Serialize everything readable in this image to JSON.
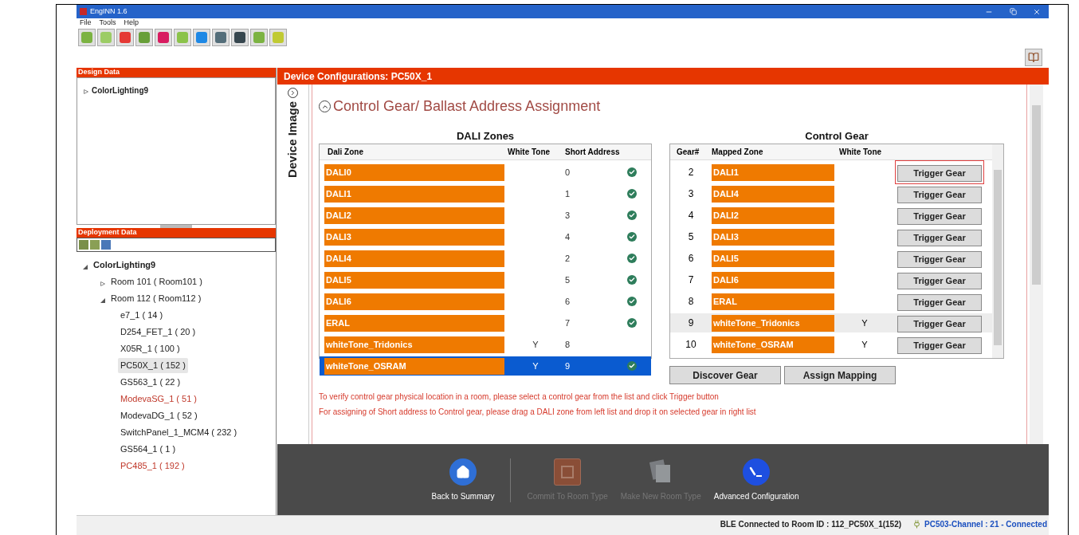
{
  "window": {
    "title": "EngINN 1.6"
  },
  "menu": [
    "File",
    "Tools",
    "Help"
  ],
  "design_data": {
    "title": "Design Data",
    "tree": [
      {
        "label": "ColorLighting9",
        "expanded": false
      }
    ]
  },
  "deployment_data": {
    "title": "Deployment Data",
    "tree": [
      {
        "label": "ColorLighting9",
        "expanded": true,
        "children": [
          {
            "label": "Room 101 ( Room101 )",
            "expanded": false
          },
          {
            "label": "Room 112 ( Room112 )",
            "expanded": true,
            "children": [
              {
                "label": "e7_1  ( 14 )",
                "selected": false,
                "color": "#222222"
              },
              {
                "label": "D254_FET_1  ( 20 )",
                "selected": false,
                "color": "#222222"
              },
              {
                "label": "X05R_1  ( 100 )",
                "selected": false,
                "color": "#222222"
              },
              {
                "label": "PC50X_1  ( 152 )",
                "selected": true,
                "color": "#222222"
              },
              {
                "label": "GS563_1  ( 22 )",
                "selected": false,
                "color": "#222222"
              },
              {
                "label": "ModevaSG_1  ( 51 )",
                "selected": false,
                "color": "#c0392b"
              },
              {
                "label": "ModevaDG_1  ( 52 )",
                "selected": false,
                "color": "#222222"
              },
              {
                "label": "SwitchPanel_1_MCM4  ( 232 )",
                "selected": false,
                "color": "#222222"
              },
              {
                "label": "GS564_1  ( 1 )",
                "selected": false,
                "color": "#222222"
              },
              {
                "label": "PC485_1  ( 192 )",
                "selected": false,
                "color": "#c0392b"
              }
            ]
          }
        ]
      }
    ]
  },
  "device_config": {
    "title": "Device Configurations: PC50X_1",
    "side_tab": "Device Image",
    "section_title": "Control Gear/ Ballast Address Assignment",
    "dali_zones": {
      "title": "DALI Zones",
      "columns": [
        "Dali Zone",
        "White Tone",
        "Short Address"
      ],
      "rows": [
        {
          "zone": "DALI0",
          "white_tone": "",
          "address": "0",
          "mapped": true,
          "selected": false
        },
        {
          "zone": "DALI1",
          "white_tone": "",
          "address": "1",
          "mapped": true,
          "selected": false
        },
        {
          "zone": "DALI2",
          "white_tone": "",
          "address": "3",
          "mapped": true,
          "selected": false
        },
        {
          "zone": "DALI3",
          "white_tone": "",
          "address": "4",
          "mapped": true,
          "selected": false
        },
        {
          "zone": "DALI4",
          "white_tone": "",
          "address": "2",
          "mapped": true,
          "selected": false
        },
        {
          "zone": "DALI5",
          "white_tone": "",
          "address": "5",
          "mapped": true,
          "selected": false
        },
        {
          "zone": "DALI6",
          "white_tone": "",
          "address": "6",
          "mapped": true,
          "selected": false
        },
        {
          "zone": "ERAL",
          "white_tone": "",
          "address": "7",
          "mapped": true,
          "selected": false
        },
        {
          "zone": "whiteTone_Tridonics",
          "white_tone": "Y",
          "address": "8",
          "mapped": false,
          "selected": false
        },
        {
          "zone": "whiteTone_OSRAM",
          "white_tone": "Y",
          "address": "9",
          "mapped": true,
          "selected": true
        }
      ]
    },
    "control_gear": {
      "title": "Control Gear",
      "columns": [
        "Gear#",
        "Mapped Zone",
        "White Tone"
      ],
      "rows": [
        {
          "gear": "2",
          "zone": "DALI1",
          "white_tone": "",
          "button": "Trigger Gear",
          "selected": false,
          "highlighted": true
        },
        {
          "gear": "3",
          "zone": "DALI4",
          "white_tone": "",
          "button": "Trigger Gear",
          "selected": false,
          "highlighted": false
        },
        {
          "gear": "4",
          "zone": "DALI2",
          "white_tone": "",
          "button": "Trigger Gear",
          "selected": false,
          "highlighted": false
        },
        {
          "gear": "5",
          "zone": "DALI3",
          "white_tone": "",
          "button": "Trigger Gear",
          "selected": false,
          "highlighted": false
        },
        {
          "gear": "6",
          "zone": "DALI5",
          "white_tone": "",
          "button": "Trigger Gear",
          "selected": false,
          "highlighted": false
        },
        {
          "gear": "7",
          "zone": "DALI6",
          "white_tone": "",
          "button": "Trigger Gear",
          "selected": false,
          "highlighted": false
        },
        {
          "gear": "8",
          "zone": "ERAL",
          "white_tone": "",
          "button": "Trigger Gear",
          "selected": false,
          "highlighted": false
        },
        {
          "gear": "9",
          "zone": "whiteTone_Tridonics",
          "white_tone": "Y",
          "button": "Trigger Gear",
          "selected": true,
          "highlighted": false
        },
        {
          "gear": "10",
          "zone": "whiteTone_OSRAM",
          "white_tone": "Y",
          "button": "Trigger Gear",
          "selected": false,
          "highlighted": false
        }
      ]
    },
    "buttons": [
      "Discover Gear",
      "Assign Mapping"
    ],
    "notes": [
      "To verify control gear physical location in a room, please select a control gear from the list and click Trigger button",
      "For assigning of Short address to Control gear, please drag a DALI zone from left list and drop it on selected gear in right list"
    ]
  },
  "actions": [
    {
      "kind": "home",
      "label": "Back to Summary",
      "disabled": false
    },
    {
      "kind": "commit",
      "label": "Commit To Room Type",
      "disabled": true
    },
    {
      "kind": "copy",
      "label": "Make New Room Type",
      "disabled": true
    },
    {
      "kind": "advanced",
      "label": "Advanced Configuration",
      "disabled": false
    }
  ],
  "status_bar": {
    "room": "BLE Connected to Room ID : 112_PC50X_1(152)",
    "channel": "PC503-Channel : 21 - Connected"
  }
}
